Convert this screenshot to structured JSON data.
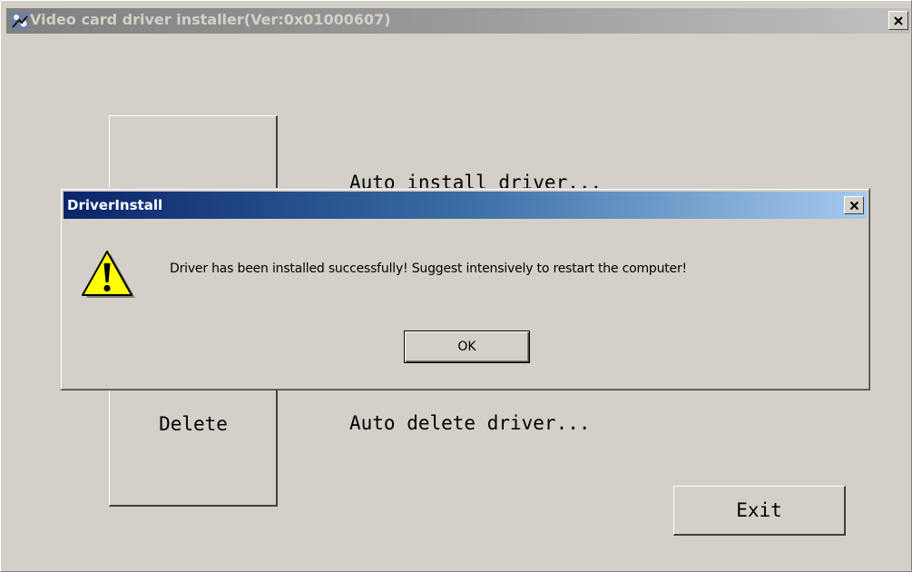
{
  "main_window": {
    "title": "Video card driver installer(Ver:0x01000607)",
    "icon": "installer-app-icon",
    "close_icon": "close-icon",
    "install_description": "Auto install driver...",
    "delete_label": "Delete",
    "delete_description": "Auto delete driver...",
    "exit_label": "Exit"
  },
  "dialog": {
    "title": "DriverInstall",
    "close_icon": "close-icon",
    "icon": "warning-icon",
    "message": "Driver has been installed successfully! Suggest intensively to restart the computer!",
    "ok_label": "OK"
  },
  "colors": {
    "face": "#d4d0c8",
    "active_title_start": "#0a246a",
    "active_title_end": "#a6caf0",
    "inactive_title": "#808080"
  }
}
